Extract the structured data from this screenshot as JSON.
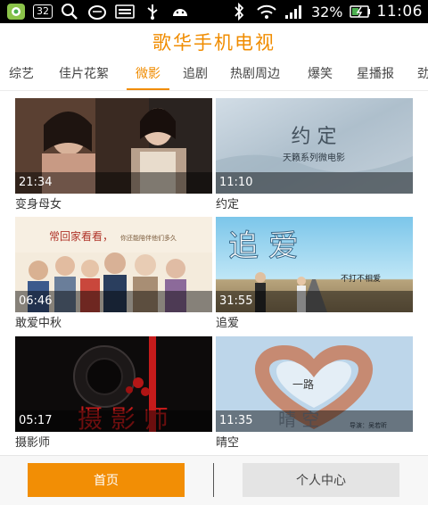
{
  "status_bar": {
    "notification_count": "32",
    "battery_percent": "32%",
    "time": "11:06"
  },
  "app": {
    "title": "歌华手机电视"
  },
  "tabs": [
    {
      "label": "综艺"
    },
    {
      "label": "佳片花絮"
    },
    {
      "label": "微影",
      "active": true
    },
    {
      "label": "追剧"
    },
    {
      "label": "热剧周边"
    },
    {
      "label": "爆笑"
    },
    {
      "label": "星播报"
    },
    {
      "label": "劲"
    }
  ],
  "videos": [
    {
      "duration": "21:34",
      "title": "变身母女"
    },
    {
      "duration": "11:10",
      "title": "约定",
      "poster_title": "约 定",
      "poster_subtitle": "天籁系列微电影"
    },
    {
      "duration": "06:46",
      "title": "敢爱中秋",
      "poster_title": "常回家看看，",
      "poster_subtitle": "你还能陪伴他们多久"
    },
    {
      "duration": "31:55",
      "title": "追爱",
      "poster_title": "追 爱",
      "poster_subtitle": "不打不相爱"
    },
    {
      "duration": "05:17",
      "title": "摄影师",
      "poster_title": "摄 影 师"
    },
    {
      "duration": "11:35",
      "title": "晴空",
      "poster_title": "晴 空",
      "poster_subtitle": "导演：吴若昕",
      "poster_mark": "一路"
    }
  ],
  "bottom_nav": {
    "home_label": "首页",
    "profile_label": "个人中心"
  },
  "colors": {
    "accent": "#f08c00",
    "home_button": "#f28e05"
  }
}
